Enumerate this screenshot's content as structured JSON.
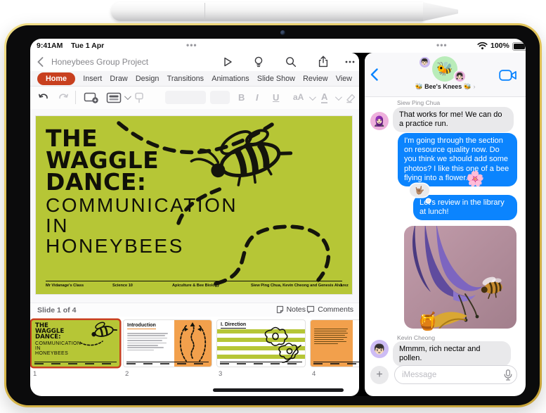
{
  "status_bar": {
    "time": "9:41AM",
    "date": "Tue 1 Apr",
    "left_handle": "•••",
    "right_handle": "•••",
    "battery_percent": "100%"
  },
  "powerpoint": {
    "document_title": "Honeybees Group Project",
    "tabs": [
      "Home",
      "Insert",
      "Draw",
      "Design",
      "Transitions",
      "Animations",
      "Slide Show",
      "Review",
      "View"
    ],
    "ribbon": {
      "bold": "B",
      "italic": "I",
      "underline": "U",
      "font_size": "aA",
      "font_color": "A"
    },
    "slide": {
      "title_line1": "THE",
      "title_line2": "WAGGLE",
      "title_line3": "DANCE:",
      "subtitle_line1": "COMMUNICATION",
      "subtitle_line2": "IN",
      "subtitle_line3": "HONEYBEES",
      "footer_class": "Mr Vidanage's Class",
      "footer_course": "Science 10",
      "footer_subject": "Apiculture & Bee Biology",
      "footer_authors": "Siew Ping Chua, Kevin Cheong and Genesis Alvarez",
      "page_number": "1"
    },
    "status_row": {
      "slide_label": "Slide 1 of 4",
      "notes_label": "Notes",
      "comments_label": "Comments"
    },
    "thumbnails": {
      "t1": {
        "number": "1"
      },
      "t2": {
        "number": "2",
        "title": "Introduction"
      },
      "t3": {
        "number": "3",
        "title": "I. Direction"
      },
      "t4": {
        "number": "4"
      }
    }
  },
  "messages": {
    "group_name": "🐝 Bee's Knees 🐝",
    "group_chevron": "›",
    "group_avatar_emoji": "🐝",
    "member_avatar_top": "👦🏻",
    "member_avatar_bottom": "👧🏻",
    "sender1_name": "Siew Ping Chua",
    "sender1_avatar": "🧕🏻",
    "sender2_name": "Kevin Cheong",
    "sender2_avatar": "👦🏻",
    "bubble1": "That works for me! We can do a practice run.",
    "bubble2": "I'm going through the section on resource quality now. Do you think we should add some photos? I like this one of a bee flying into a flower.",
    "bubble3": "Let's review in the library at lunch!",
    "bubble4": "Mmmm, rich nectar and pollen.",
    "flower_sticker": "🌸",
    "honey_sticker": "🍯",
    "tapback_emoji": "🤟🏽",
    "input_placeholder": "iMessage",
    "plus_label": "+"
  }
}
